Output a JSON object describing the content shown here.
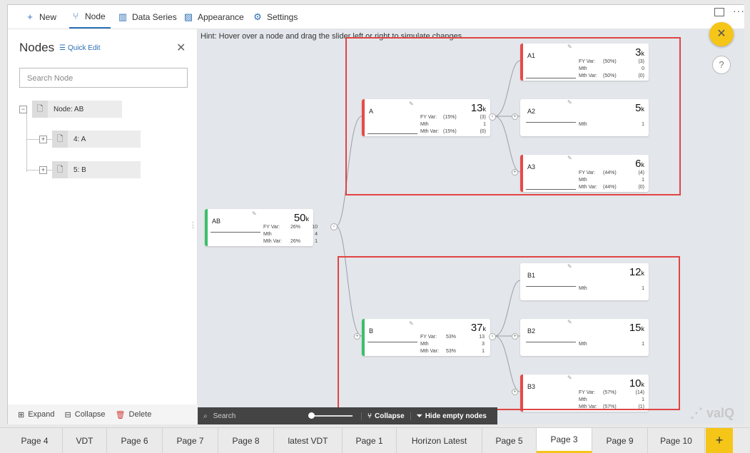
{
  "toolbar": {
    "new_label": "New",
    "node_label": "Node",
    "data_series_label": "Data Series",
    "appearance_label": "Appearance",
    "settings_label": "Settings"
  },
  "panel": {
    "title": "Nodes",
    "quick_edit": "Quick Edit",
    "search_placeholder": "Search Node",
    "tree": [
      {
        "label": "Node: AB"
      },
      {
        "label": "4: A"
      },
      {
        "label": "5: B"
      }
    ],
    "actions": {
      "expand": "Expand",
      "collapse": "Collapse",
      "delete": "Delete"
    }
  },
  "canvas": {
    "hint": "Hint: Hover over a node and drag the slider left or right to simulate changes",
    "nodes": {
      "AB": {
        "name": "AB",
        "value": "50",
        "unit": "k",
        "color": "#3cbf6a",
        "rows": [
          [
            "FY Var:",
            "26%",
            "10"
          ],
          [
            "Mth",
            "",
            "4"
          ],
          [
            "Mth Var:",
            "26%",
            "1"
          ]
        ]
      },
      "A": {
        "name": "A",
        "value": "13",
        "unit": "k",
        "color": "#e84a4a",
        "rows": [
          [
            "FY Var:",
            "(15%)",
            "(3)"
          ],
          [
            "Mth",
            "",
            "1"
          ],
          [
            "Mth Var:",
            "(15%)",
            "(0)"
          ]
        ]
      },
      "B": {
        "name": "B",
        "value": "37",
        "unit": "k",
        "color": "#3cbf6a",
        "rows": [
          [
            "FY Var:",
            "53%",
            "13"
          ],
          [
            "Mth",
            "",
            "3"
          ],
          [
            "Mth Var:",
            "53%",
            "1"
          ]
        ]
      },
      "A1": {
        "name": "A1",
        "value": "3",
        "unit": "k",
        "color": "#e84a4a",
        "rows": [
          [
            "FY Var:",
            "(50%)",
            "(3)"
          ],
          [
            "Mth",
            "",
            "0"
          ],
          [
            "Mth Var:",
            "(50%)",
            "(0)"
          ]
        ]
      },
      "A2": {
        "name": "A2",
        "value": "5",
        "unit": "k",
        "color": "",
        "rows": [
          [
            "Mth",
            "",
            "1"
          ]
        ]
      },
      "A3": {
        "name": "A3",
        "value": "6",
        "unit": "k",
        "color": "#e84a4a",
        "rows": [
          [
            "FY Var:",
            "(44%)",
            "(4)"
          ],
          [
            "Mth",
            "",
            "1"
          ],
          [
            "Mth Var:",
            "(44%)",
            "(0)"
          ]
        ]
      },
      "B1": {
        "name": "B1",
        "value": "12",
        "unit": "k",
        "color": "",
        "rows": [
          [
            "Mth",
            "",
            "1"
          ]
        ]
      },
      "B2": {
        "name": "B2",
        "value": "15",
        "unit": "k",
        "color": "",
        "rows": [
          [
            "Mth",
            "",
            "1"
          ]
        ]
      },
      "B3": {
        "name": "B3",
        "value": "10",
        "unit": "k",
        "color": "#e84a4a",
        "rows": [
          [
            "FY Var:",
            "(57%)",
            "(14)"
          ],
          [
            "Mth",
            "",
            "1"
          ],
          [
            "Mth Var:",
            "(57%)",
            "(1)"
          ]
        ]
      }
    },
    "bottombar": {
      "search_label": "Search",
      "collapse_label": "Collapse",
      "hide_empty_label": "Hide empty nodes"
    },
    "logo_text": "valQ"
  },
  "tabs": [
    "Page 4",
    "VDT",
    "Page 6",
    "Page 7",
    "Page 8",
    "latest VDT",
    "Page 1",
    "Horizon Latest",
    "Page 5",
    "Page 3",
    "Page 9",
    "Page 10"
  ],
  "active_tab": "Page 3"
}
